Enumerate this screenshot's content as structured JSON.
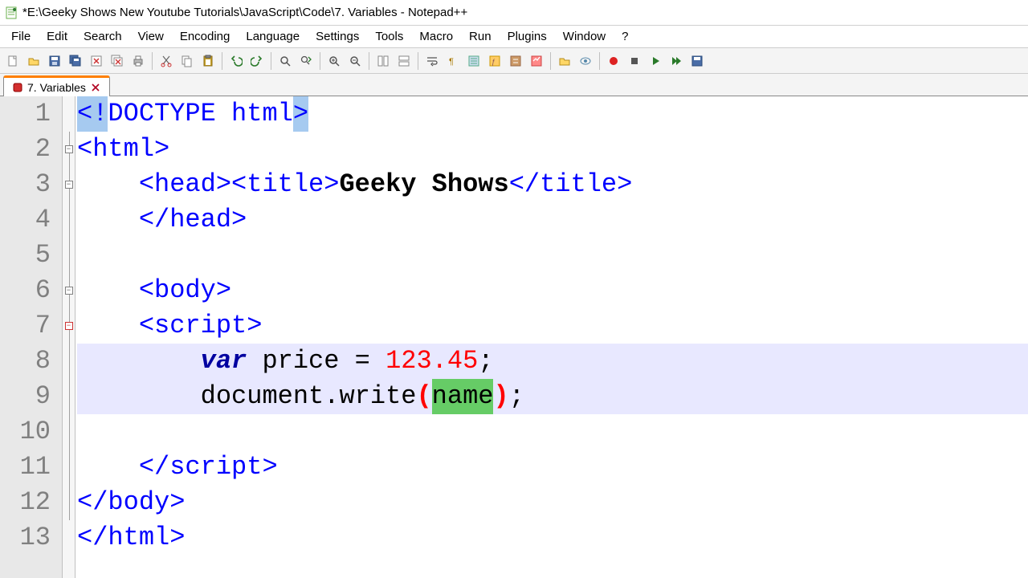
{
  "window": {
    "title": "*E:\\Geeky Shows New Youtube Tutorials\\JavaScript\\Code\\7. Variables - Notepad++"
  },
  "menu": {
    "items": [
      "File",
      "Edit",
      "Search",
      "View",
      "Encoding",
      "Language",
      "Settings",
      "Tools",
      "Macro",
      "Run",
      "Plugins",
      "Window",
      "?"
    ]
  },
  "toolbar": {
    "buttons": [
      "new-file",
      "open-file",
      "save",
      "save-all",
      "close",
      "close-all",
      "print",
      "|",
      "cut",
      "copy",
      "paste",
      "|",
      "undo",
      "redo",
      "|",
      "find",
      "replace",
      "|",
      "zoom-in",
      "zoom-out",
      "|",
      "sync-v",
      "sync-h",
      "|",
      "wrap",
      "show-all",
      "indent-guide",
      "user-lang",
      "fold",
      "doc-map",
      "|",
      "func-list",
      "monitor",
      "|",
      "record",
      "stop",
      "play",
      "play-multi",
      "save-macro"
    ]
  },
  "tab": {
    "label": "7. Variables",
    "modified": true
  },
  "code": {
    "lines": [
      {
        "n": 1,
        "fold": "",
        "seg": [
          [
            "sel-bg t-ang",
            "<"
          ],
          [
            "sel-bg t-tag",
            "!"
          ],
          [
            "t-tag",
            "DOCTYPE html"
          ],
          [
            "sel-bg t-ang",
            ">"
          ]
        ]
      },
      {
        "n": 2,
        "fold": "box",
        "seg": [
          [
            "t-ang",
            "<"
          ],
          [
            "t-tag",
            "html"
          ],
          [
            "t-ang",
            ">"
          ]
        ]
      },
      {
        "n": 3,
        "fold": "box",
        "seg": [
          [
            "",
            "    "
          ],
          [
            "t-ang",
            "<"
          ],
          [
            "t-tag",
            "head"
          ],
          [
            "t-ang",
            ">"
          ],
          [
            "t-ang",
            "<"
          ],
          [
            "t-tag",
            "title"
          ],
          [
            "t-ang",
            ">"
          ],
          [
            "t-text",
            "Geeky Shows"
          ],
          [
            "t-ang",
            "</"
          ],
          [
            "t-tag",
            "title"
          ],
          [
            "t-ang",
            ">"
          ]
        ]
      },
      {
        "n": 4,
        "fold": "vline",
        "seg": [
          [
            "",
            "    "
          ],
          [
            "t-ang",
            "</"
          ],
          [
            "t-tag",
            "head"
          ],
          [
            "t-ang",
            ">"
          ]
        ]
      },
      {
        "n": 5,
        "fold": "vline",
        "seg": [
          [
            "",
            ""
          ]
        ]
      },
      {
        "n": 6,
        "fold": "box",
        "seg": [
          [
            "",
            "    "
          ],
          [
            "t-ang",
            "<"
          ],
          [
            "t-tag",
            "body"
          ],
          [
            "t-ang",
            ">"
          ]
        ]
      },
      {
        "n": 7,
        "fold": "boxr",
        "seg": [
          [
            "",
            "    "
          ],
          [
            "t-ang",
            "<"
          ],
          [
            "t-tag",
            "script"
          ],
          [
            "t-ang",
            ">"
          ]
        ]
      },
      {
        "n": 8,
        "fold": "vline",
        "hl": true,
        "seg": [
          [
            "",
            "        "
          ],
          [
            "t-kw",
            "var"
          ],
          [
            "",
            " "
          ],
          [
            "t-ident",
            "price"
          ],
          [
            "",
            " "
          ],
          [
            "t-op",
            "="
          ],
          [
            "",
            " "
          ],
          [
            "t-num",
            "123.45"
          ],
          [
            "t-s",
            ";"
          ]
        ]
      },
      {
        "n": 9,
        "fold": "vline",
        "hl": true,
        "seg": [
          [
            "",
            "        "
          ],
          [
            "t-ident",
            "document.write"
          ],
          [
            "t-paren-match",
            "("
          ],
          [
            "t-selword",
            "name"
          ],
          [
            "t-paren-match",
            ")"
          ],
          [
            "t-s",
            ";"
          ]
        ]
      },
      {
        "n": 10,
        "fold": "vline",
        "seg": [
          [
            "",
            ""
          ]
        ]
      },
      {
        "n": 11,
        "fold": "vline",
        "seg": [
          [
            "",
            "    "
          ],
          [
            "t-ang",
            "</"
          ],
          [
            "t-tag",
            "script"
          ],
          [
            "t-ang",
            ">"
          ]
        ]
      },
      {
        "n": 12,
        "fold": "vline",
        "seg": [
          [
            "t-ang",
            "</"
          ],
          [
            "t-tag",
            "body"
          ],
          [
            "t-ang",
            ">"
          ]
        ]
      },
      {
        "n": 13,
        "fold": "",
        "seg": [
          [
            "t-ang",
            "</"
          ],
          [
            "t-tag",
            "html"
          ],
          [
            "t-ang",
            ">"
          ]
        ]
      }
    ]
  }
}
